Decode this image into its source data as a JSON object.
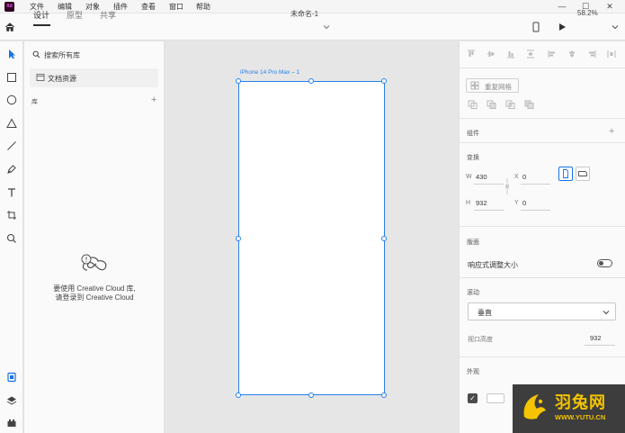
{
  "menubar": {
    "app_logo": "Xd",
    "items": [
      "文件",
      "编辑",
      "对象",
      "插件",
      "查看",
      "窗口",
      "帮助"
    ],
    "window_controls": [
      "—",
      "☐",
      "✕"
    ]
  },
  "toolbar": {
    "tabs": [
      "设计",
      "原型",
      "共享"
    ],
    "active_tab": "设计",
    "doc_title": "未命名-1",
    "zoom": "58.2%"
  },
  "tools": [
    "select-tool",
    "rectangle-tool",
    "ellipse-tool",
    "polygon-tool",
    "line-tool",
    "pen-tool",
    "text-tool",
    "artboard-tool",
    "zoom-tool"
  ],
  "libraries": {
    "search_placeholder": "搜索所有库",
    "doc_assets": "文档资源",
    "header": "库",
    "add": "+",
    "cc_message_line1": "要使用 Creative Cloud 库,",
    "cc_message_line2": "请登录到 Creative Cloud"
  },
  "canvas": {
    "artboard_label": "iPhone 14 Pro Max – 1"
  },
  "inspector": {
    "repeat_grid": "重复网格",
    "components": {
      "title": "组件",
      "add": "+"
    },
    "transform": {
      "title": "变换",
      "w_label": "W",
      "w_value": "430",
      "x_label": "X",
      "x_value": "0",
      "h_label": "H",
      "h_value": "932",
      "y_label": "Y",
      "y_value": "0"
    },
    "layout": {
      "title": "版面",
      "responsive_label": "响应式调整大小"
    },
    "scroll": {
      "title": "滚动",
      "option": "垂直",
      "viewport_label": "视口高度",
      "viewport_value": "932"
    },
    "appearance": {
      "title": "外观"
    }
  },
  "watermark": {
    "title": "羽兔网",
    "url": "WWW.YUTU.CN"
  }
}
